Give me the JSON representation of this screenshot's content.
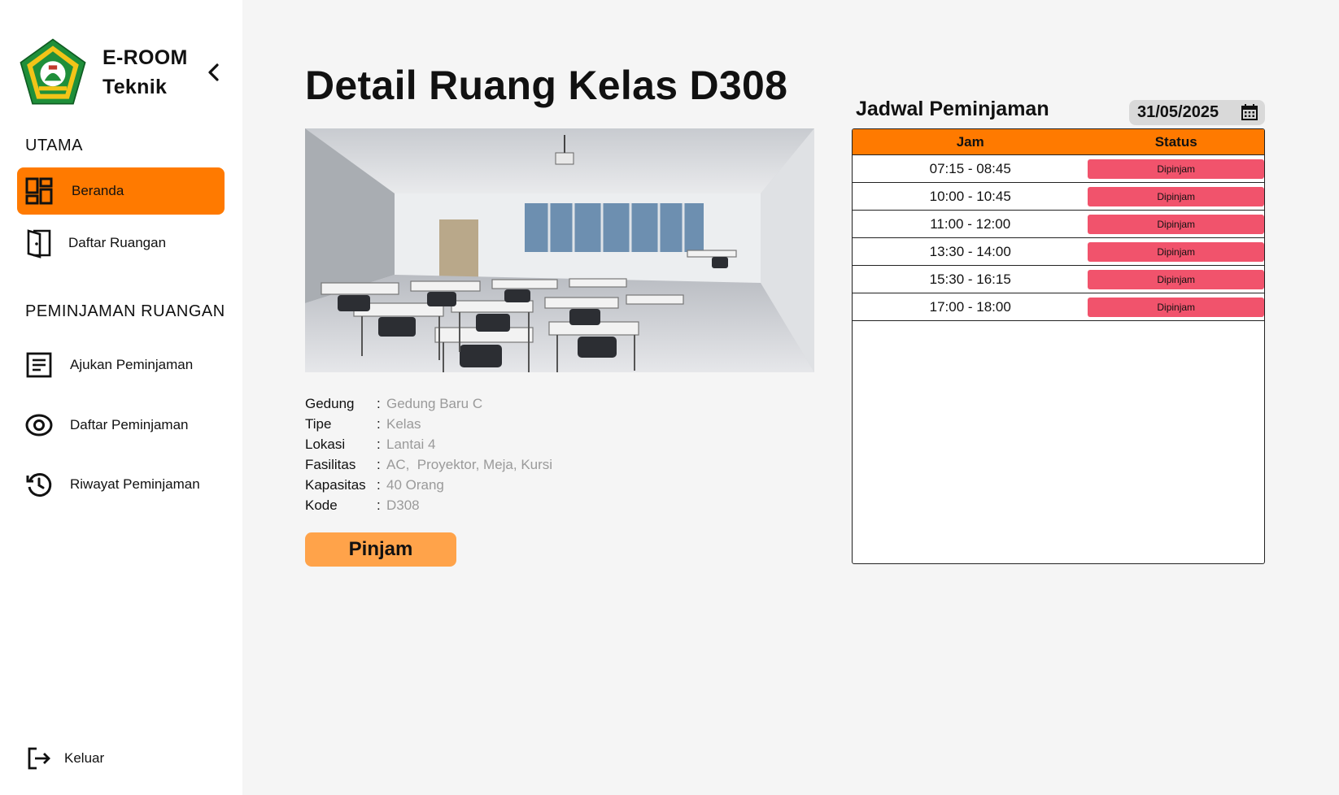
{
  "brand": {
    "line1": "E-ROOM",
    "line2": "Teknik"
  },
  "sidebar": {
    "section_main": "UTAMA",
    "main_items": [
      {
        "label": "Beranda",
        "icon": "dashboard-icon",
        "active": true
      },
      {
        "label": "Daftar Ruangan",
        "icon": "door-icon",
        "active": false
      }
    ],
    "section_booking": "PEMINJAMAN RUANGAN",
    "booking_items": [
      {
        "label": "Ajukan Peminjaman",
        "icon": "form-icon"
      },
      {
        "label": "Daftar Peminjaman",
        "icon": "eye-icon"
      },
      {
        "label": "Riwayat Peminjaman",
        "icon": "history-icon"
      }
    ],
    "logout": "Keluar"
  },
  "main": {
    "title": "Detail Ruang Kelas D308",
    "details": [
      {
        "label": "Gedung",
        "value": "Gedung Baru C"
      },
      {
        "label": "Tipe",
        "value": "Kelas"
      },
      {
        "label": "Lokasi",
        "value": "Lantai 4"
      },
      {
        "label": "Fasilitas",
        "value": "AC,  Proyektor, Meja, Kursi"
      },
      {
        "label": "Kapasitas",
        "value": "40 Orang"
      },
      {
        "label": "Kode",
        "value": "D308"
      }
    ],
    "colon": ":",
    "button": "Pinjam"
  },
  "schedule": {
    "title": "Jadwal Peminjaman",
    "date": "31/05/2025",
    "headers": {
      "jam": "Jam",
      "status": "Status"
    },
    "rows": [
      {
        "jam": "07:15 - 08:45",
        "status": "Dipinjam"
      },
      {
        "jam": "10:00 - 10:45",
        "status": "Dipinjam"
      },
      {
        "jam": "11:00 - 12:00",
        "status": "Dipinjam"
      },
      {
        "jam": "13:30 - 14:00",
        "status": "Dipinjam"
      },
      {
        "jam": "15:30 - 16:15",
        "status": "Dipinjam"
      },
      {
        "jam": "17:00 - 18:00",
        "status": "Dipinjam"
      }
    ]
  },
  "colors": {
    "accent": "#ff7a00",
    "button": "#ffa34a",
    "status_booked": "#f1536c",
    "background": "#f5f5f5"
  }
}
